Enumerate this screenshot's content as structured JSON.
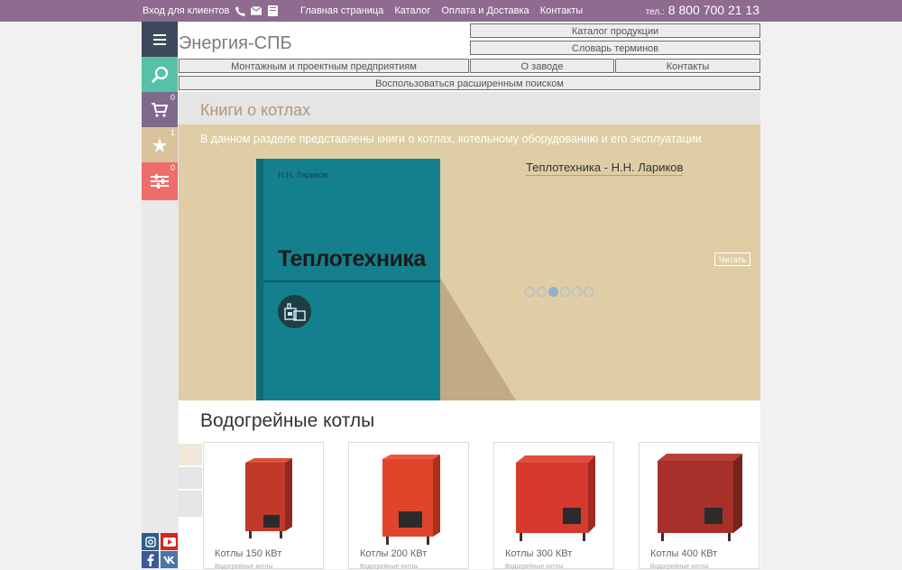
{
  "topbar": {
    "login_label": "Вход для клиентов",
    "icons": [
      "phone-icon",
      "mail-icon",
      "book-icon"
    ],
    "nav": [
      "Главная страница",
      "Каталог",
      "Оплата и Доставка",
      "Контакты"
    ],
    "phone_prefix": "тел.:",
    "phone_number": "8 800 700 21 13"
  },
  "sidebar": {
    "items": [
      {
        "icon": "menu-icon",
        "color": "#3e4a5c",
        "badge": ""
      },
      {
        "icon": "search-icon",
        "color": "#56c1a7",
        "badge": ""
      },
      {
        "icon": "cart-icon",
        "color": "#7e6a8c",
        "badge": "0"
      },
      {
        "icon": "star-icon",
        "color": "#d8c39c",
        "badge": "1"
      },
      {
        "icon": "sliders-icon",
        "color": "#ee6c6c",
        "badge": "0"
      }
    ],
    "social": [
      "instagram-icon",
      "youtube-icon",
      "facebook-icon",
      "vk-icon"
    ]
  },
  "header": {
    "site_title": "Энергия-СПБ",
    "buttons": {
      "catalog": "Каталог продукции",
      "glossary": "Словарь терминов",
      "installers": "Монтажным и проектным предприятиям",
      "about": "О заводе",
      "contacts": "Контакты",
      "advanced_search": "Воспользоваться расширенным поиском"
    }
  },
  "books": {
    "section_title": "Книги о котлах",
    "description": "В данном разделе представлены книги о котлах, котельному оборудованию и его эксплуатации",
    "current_title": "Теплотехника - Н.Н. Лариков",
    "read_label": "Читать",
    "cover_author": "Н.Н. Лариков",
    "cover_title": "Теплотехника",
    "slides_count": 6,
    "active_slide": 3,
    "colors": {
      "hero": "#dfcda5",
      "cover": "#14808e"
    }
  },
  "products": {
    "section_title": "Водогрейные котлы",
    "items": [
      {
        "name": "Котлы 150 КВт",
        "category": "Водогрейные котлы",
        "color": "#c0392b"
      },
      {
        "name": "Котлы 200 КВт",
        "category": "Водогрейные котлы",
        "color": "#e0442a"
      },
      {
        "name": "Котлы 300 КВт",
        "category": "Водогрейные котлы",
        "color": "#d63a2e"
      },
      {
        "name": "Котлы 400 КВт",
        "category": "Водогрейные котлы",
        "color": "#a8302a"
      }
    ]
  }
}
